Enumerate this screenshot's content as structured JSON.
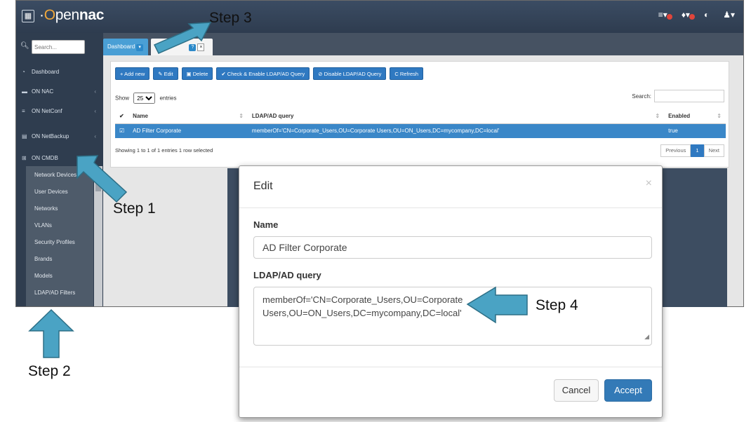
{
  "app": {
    "logo_prefix": "·",
    "logo_o": "O",
    "logo_open": "pen",
    "logo_bold": "nac",
    "grid_icon": "▦",
    "top_icons": [
      "list-icon",
      "bell-icon",
      "globe-icon",
      "user-icon"
    ]
  },
  "sidebar": {
    "search_placeholder": "Search...",
    "items": [
      {
        "icon": "dashboard-icon",
        "glyph": "◔",
        "label": "Dashboard"
      },
      {
        "icon": "graduation-icon",
        "glyph": "▬",
        "label": "ON NAC"
      },
      {
        "icon": "server-icon",
        "glyph": "≡",
        "label": "ON NetConf"
      },
      {
        "icon": "database-icon",
        "glyph": "▤",
        "label": "ON NetBackup"
      },
      {
        "icon": "grid-icon",
        "glyph": "⊞",
        "label": "ON CMDB"
      }
    ],
    "sub_items": [
      "Network Devices",
      "User Devices",
      "Networks",
      "VLANs",
      "Security Profiles",
      "Brands",
      "Models",
      "LDAP/AD Filters"
    ]
  },
  "tabs": {
    "dashboard": "Dashboard",
    "dashboard_badge": "▾",
    "second_prefix": "L",
    "second_badge": "?",
    "second_close": "×"
  },
  "toolbar": {
    "add": "+ Add new",
    "edit": "✎ Edit",
    "delete": "▣ Delete",
    "check": "✔ Check & Enable LDAP/AD Query",
    "disable": "⊘ Disable LDAP/AD Query",
    "refresh": "C Refresh"
  },
  "table": {
    "show_label": "Show",
    "show_value": "25",
    "entries_label": "entries",
    "search_label": "Search:",
    "headers": [
      "✔",
      "Name",
      "LDAP/AD query",
      "Enabled"
    ],
    "rows": [
      {
        "check": "☑",
        "name": "AD Filter Corporate",
        "query": "memberOf='CN=Corporate_Users,OU=Corporate Users,OU=ON_Users,DC=mycompany,DC=local'",
        "enabled": "true"
      }
    ],
    "info": "Showing 1 to 1 of 1 entries   1 row selected",
    "pager": {
      "previous": "Previous",
      "current": "1",
      "next": "Next"
    }
  },
  "modal": {
    "title": "Edit",
    "close": "×",
    "name_label": "Name",
    "name_value": "AD Filter Corporate",
    "query_label": "LDAP/AD query",
    "query_value": "memberOf='CN=Corporate_Users,OU=Corporate\nUsers,OU=ON_Users,DC=mycompany,DC=local'",
    "cancel": "Cancel",
    "accept": "Accept"
  },
  "callouts": {
    "step1": "Step 1",
    "step2": "Step 2",
    "step3": "Step 3",
    "step4": "Step 4",
    "arrow_color": "#4aa3c4",
    "arrow_stroke": "#2d6f86"
  }
}
